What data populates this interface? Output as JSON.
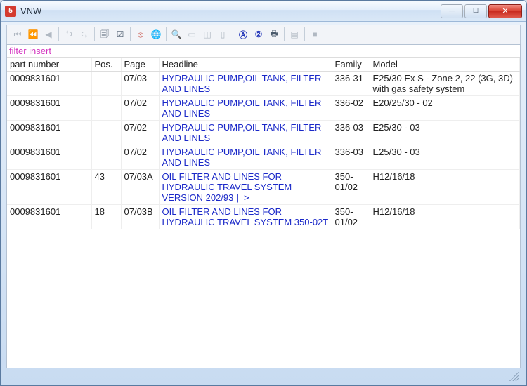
{
  "window": {
    "title": "VNW"
  },
  "filter_label": "filter insert",
  "columns": {
    "part_number": "part number",
    "pos": "Pos.",
    "page": "Page",
    "headline": "Headline",
    "family": "Family",
    "model": "Model"
  },
  "rows": [
    {
      "part_number": "0009831601",
      "pos": "",
      "page": "07/03",
      "headline": "HYDRAULIC PUMP,OIL TANK,  FILTER AND LINES",
      "family": "336-31",
      "model": "E25/30 Ex S - Zone 2, 22 (3G, 3D) with gas safety system"
    },
    {
      "part_number": "0009831601",
      "pos": "",
      "page": "07/02",
      "headline": "HYDRAULIC PUMP,OIL TANK,  FILTER AND LINES",
      "family": "336-02",
      "model": "E20/25/30 - 02"
    },
    {
      "part_number": "0009831601",
      "pos": "",
      "page": "07/02",
      "headline": "HYDRAULIC PUMP,OIL TANK,  FILTER AND LINES",
      "family": "336-03",
      "model": "E25/30 - 03"
    },
    {
      "part_number": "0009831601",
      "pos": "",
      "page": "07/02",
      "headline": "HYDRAULIC PUMP,OIL TANK,  FILTER AND LINES",
      "family": "336-03",
      "model": "E25/30 - 03"
    },
    {
      "part_number": "0009831601",
      "pos": "43",
      "page": "07/03A",
      "headline": "OIL FILTER AND LINES FOR HYDRAULIC TRAVEL SYSTEM VERSION 202/93 |=>",
      "family": "350-01/02",
      "model": "H12/16/18"
    },
    {
      "part_number": "0009831601",
      "pos": "18",
      "page": "07/03B",
      "headline": "OIL FILTER AND LINES FOR HYDRAULIC TRAVEL SYSTEM 350-02T",
      "family": "350-01/02",
      "model": "H12/16/18"
    }
  ],
  "toolbar_icons": [
    "first",
    "prev-page",
    "prev",
    "sep",
    "jump-back",
    "jump-fwd",
    "sep",
    "cart",
    "checklist",
    "sep",
    "no-image",
    "globe",
    "sep",
    "zoom",
    "page1",
    "page2",
    "page-outline",
    "sep",
    "a-circle",
    "two-circle",
    "print",
    "sep",
    "doc",
    "sep",
    "stop"
  ]
}
